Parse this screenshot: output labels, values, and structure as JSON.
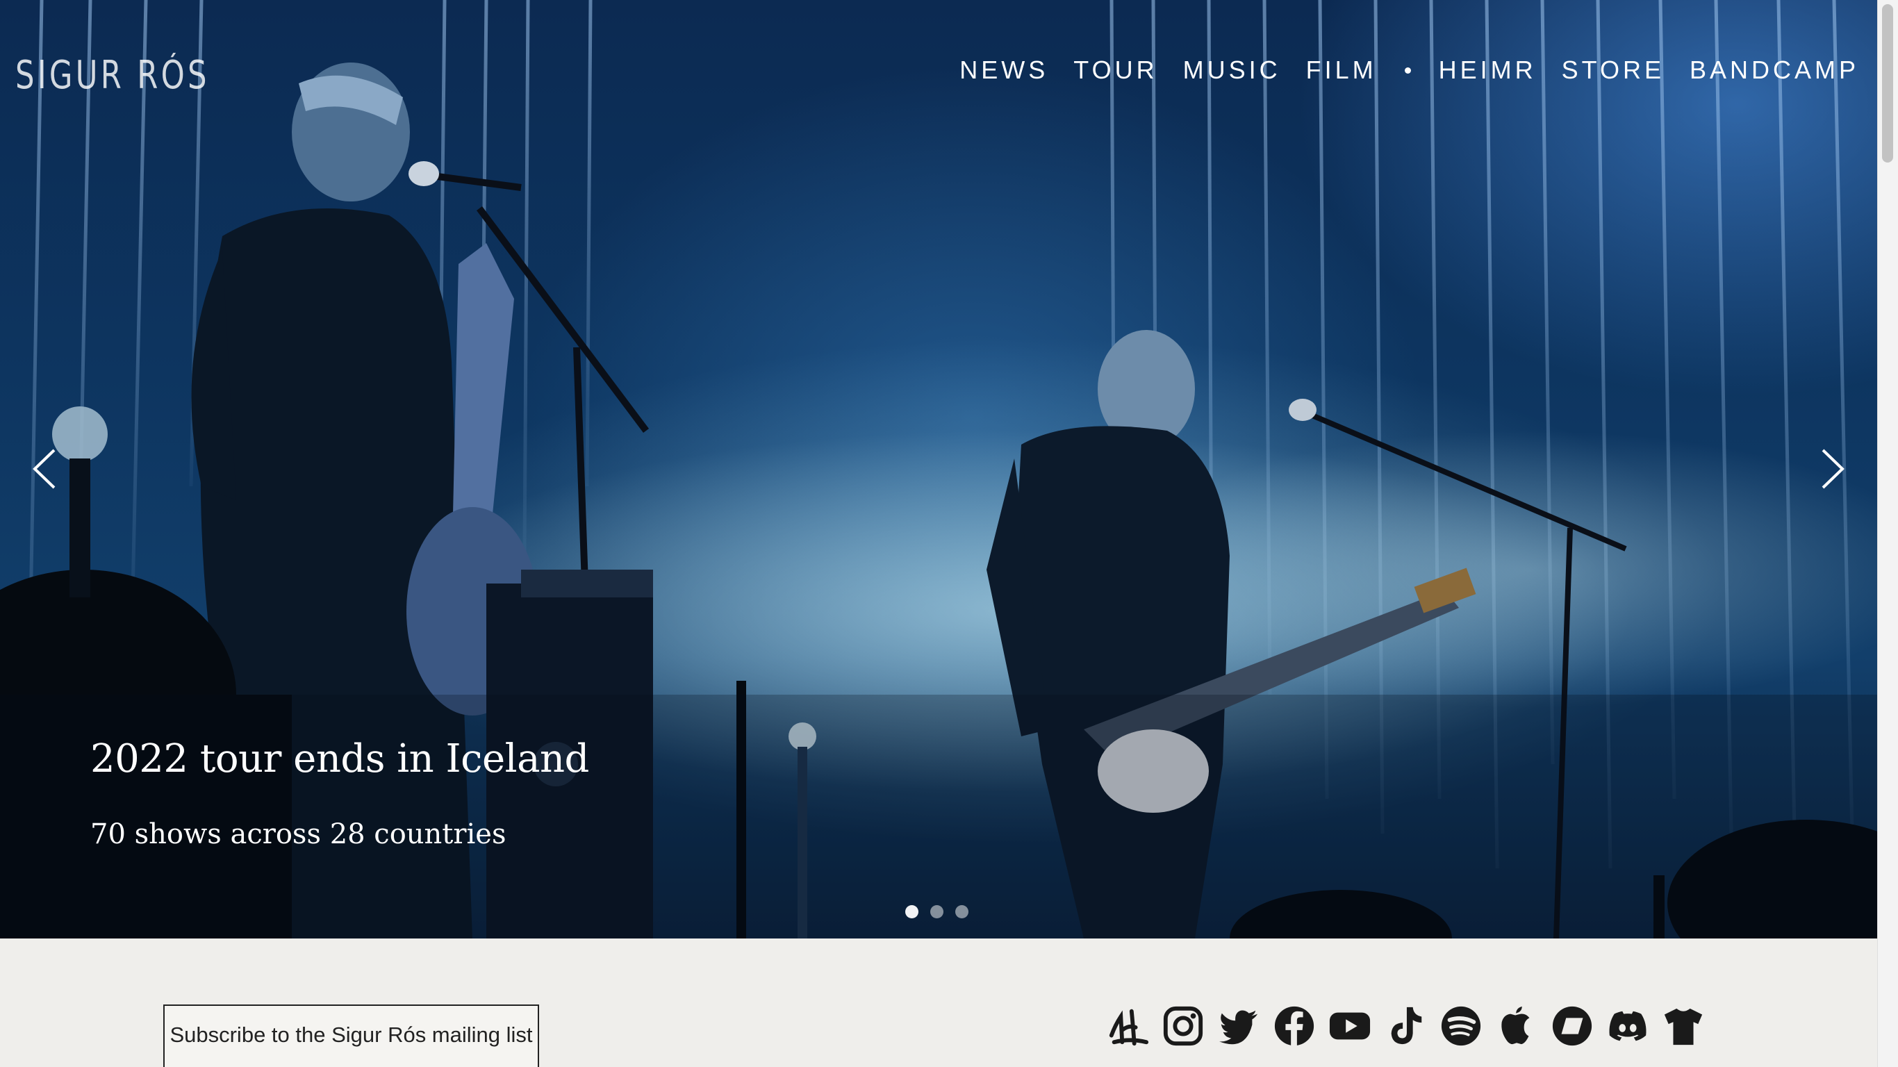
{
  "header": {
    "logo": "SIGUR RÓS",
    "nav": [
      "NEWS",
      "TOUR",
      "MUSIC",
      "FILM",
      "HEIMR",
      "STORE",
      "BANDCAMP"
    ]
  },
  "hero": {
    "title": "2022 tour ends in Iceland",
    "subtitle": "70 shows across 28 countries",
    "slide_count": 3,
    "active_slide": 1,
    "prev_icon": "chevron-left-icon",
    "next_icon": "chevron-right-icon"
  },
  "subscribe": {
    "label": "Subscribe to the Sigur Rós mailing list"
  },
  "social": {
    "icons": [
      "heimr-icon",
      "instagram-icon",
      "twitter-icon",
      "facebook-icon",
      "youtube-icon",
      "tiktok-icon",
      "spotify-icon",
      "apple-icon",
      "bandcamp-icon",
      "discord-icon",
      "tshirt-icon"
    ]
  },
  "colors": {
    "footer_bg": "#efeeeb",
    "hero_blue": "#0d3560",
    "icon_color": "#1a1a1a"
  }
}
